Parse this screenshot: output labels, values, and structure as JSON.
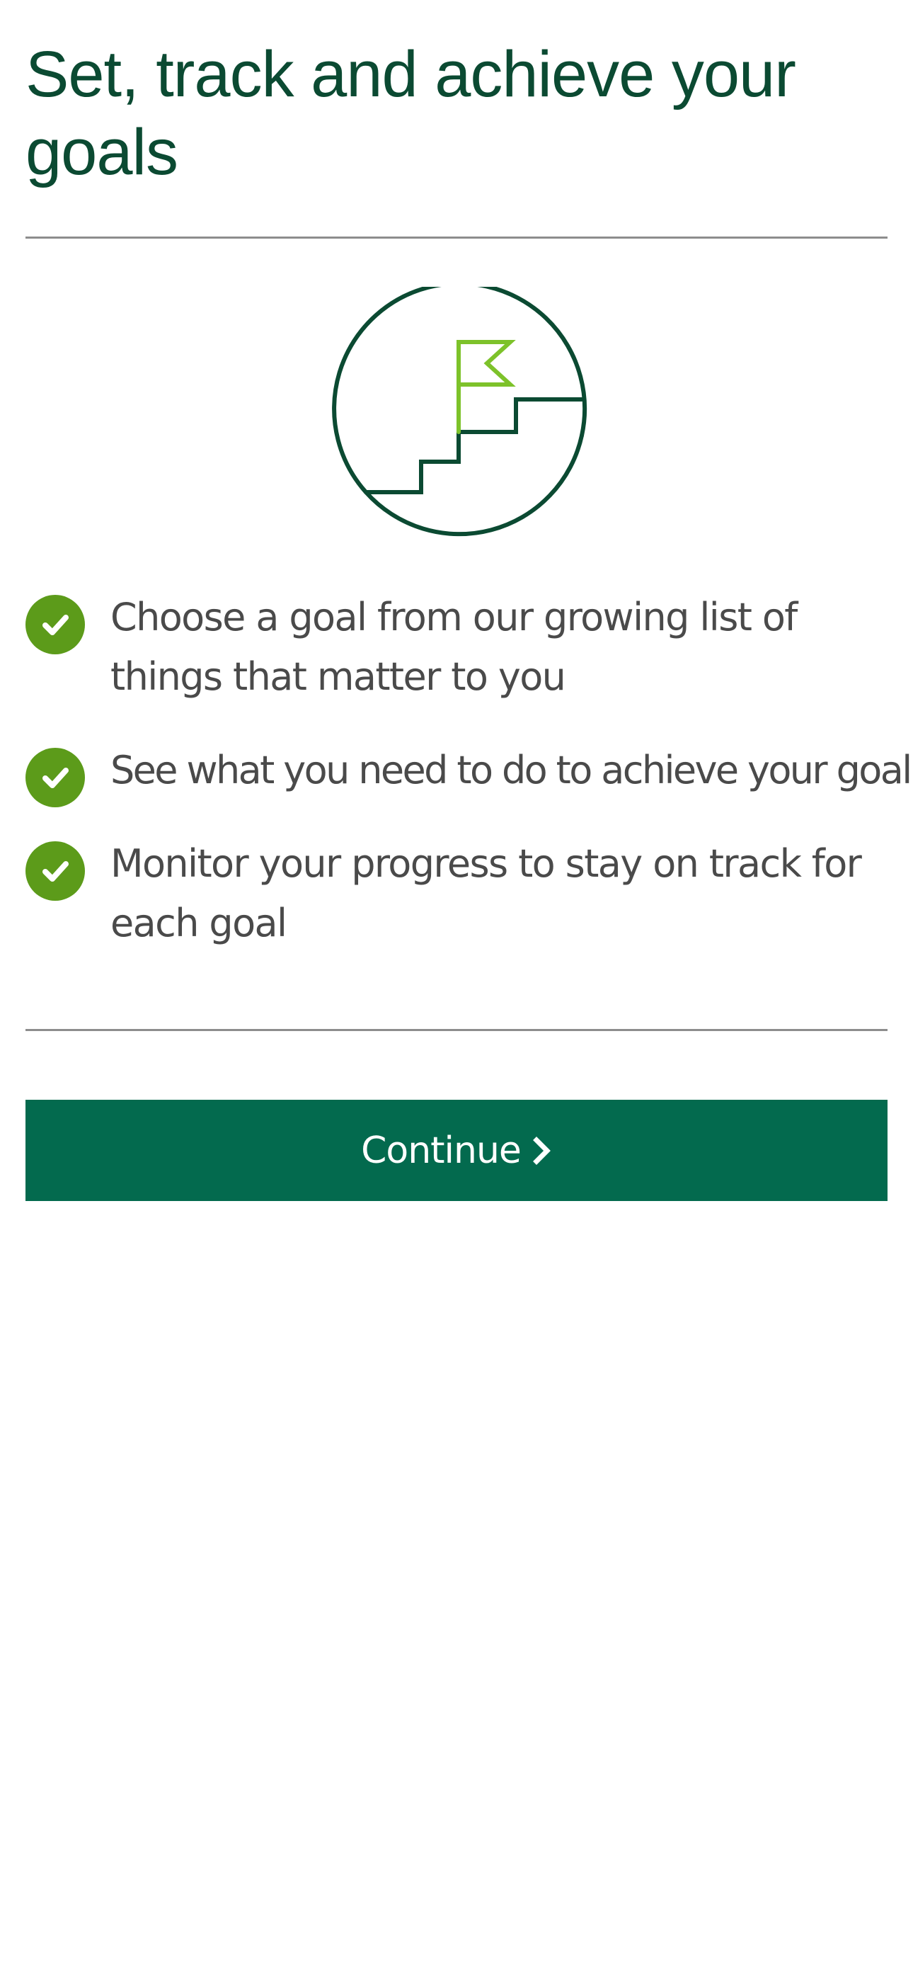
{
  "header": {
    "title": "Set, track and achieve your goals"
  },
  "illustration": {
    "icon": "goal-stairs-flag-icon",
    "colors": {
      "circle": "#0b4a32",
      "flag": "#7dc22a"
    }
  },
  "features": [
    {
      "icon": "check-circle-icon",
      "text": "Choose a goal from our growing list of things that matter to you"
    },
    {
      "icon": "check-circle-icon",
      "text": "See what you need to do to achieve your goal"
    },
    {
      "icon": "check-circle-icon",
      "text": "Monitor your progress to stay on track for each goal"
    }
  ],
  "actions": {
    "continue_label": "Continue",
    "continue_icon": "chevron-right-icon"
  },
  "colors": {
    "title": "#0b4a32",
    "body_text": "#4a4a4a",
    "check": "#5c9b1a",
    "button": "#036a4e",
    "divider": "#8d8d8d"
  }
}
